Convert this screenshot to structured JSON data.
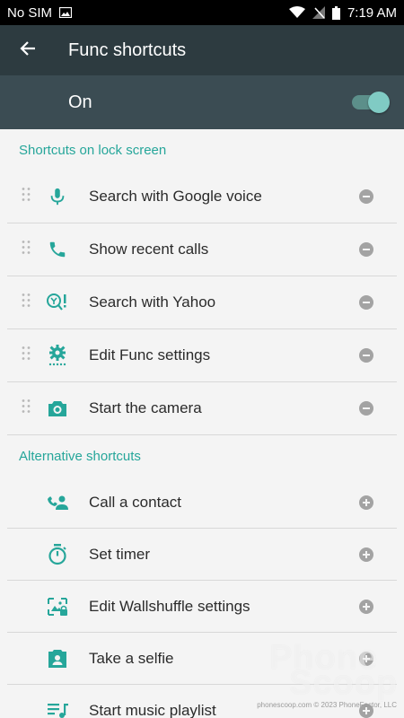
{
  "status_bar": {
    "carrier": "No SIM",
    "time": "7:19 AM",
    "icons": [
      "image-icon",
      "wifi-icon",
      "no-signal-icon",
      "battery-icon"
    ]
  },
  "header": {
    "back_icon": "arrow-back-icon",
    "title": "Func shortcuts"
  },
  "master_switch": {
    "label": "On",
    "state": "on",
    "accent_color": "#80cbc4"
  },
  "lock_screen": {
    "title": "Shortcuts on lock screen",
    "items": [
      {
        "label": "Search with Google voice",
        "icon": "microphone-icon",
        "action": "remove"
      },
      {
        "label": "Show recent calls",
        "icon": "phone-icon",
        "action": "remove"
      },
      {
        "label": "Search with Yahoo",
        "icon": "yahoo-search-icon",
        "action": "remove"
      },
      {
        "label": "Edit Func settings",
        "icon": "settings-gear-icon",
        "action": "remove"
      },
      {
        "label": "Start the camera",
        "icon": "camera-icon",
        "action": "remove"
      }
    ]
  },
  "alternative": {
    "title": "Alternative shortcuts",
    "items": [
      {
        "label": "Call a contact",
        "icon": "contact-phone-icon",
        "action": "add"
      },
      {
        "label": "Set timer",
        "icon": "timer-icon",
        "action": "add"
      },
      {
        "label": "Edit Wallshuffle settings",
        "icon": "wallpaper-icon",
        "action": "add"
      },
      {
        "label": "Take a selfie",
        "icon": "selfie-camera-icon",
        "action": "add"
      },
      {
        "label": "Start music playlist",
        "icon": "playlist-icon",
        "action": "add"
      }
    ]
  },
  "watermark": {
    "word1": "Phone",
    "word2": "Scoop",
    "caption": "phonescoop.com  © 2023 PhoneFactor, LLC"
  },
  "colors": {
    "app_bar": "#2d3b40",
    "master_bar": "#3b4c53",
    "accent": "#26a69a",
    "background": "#f4f4f4"
  }
}
